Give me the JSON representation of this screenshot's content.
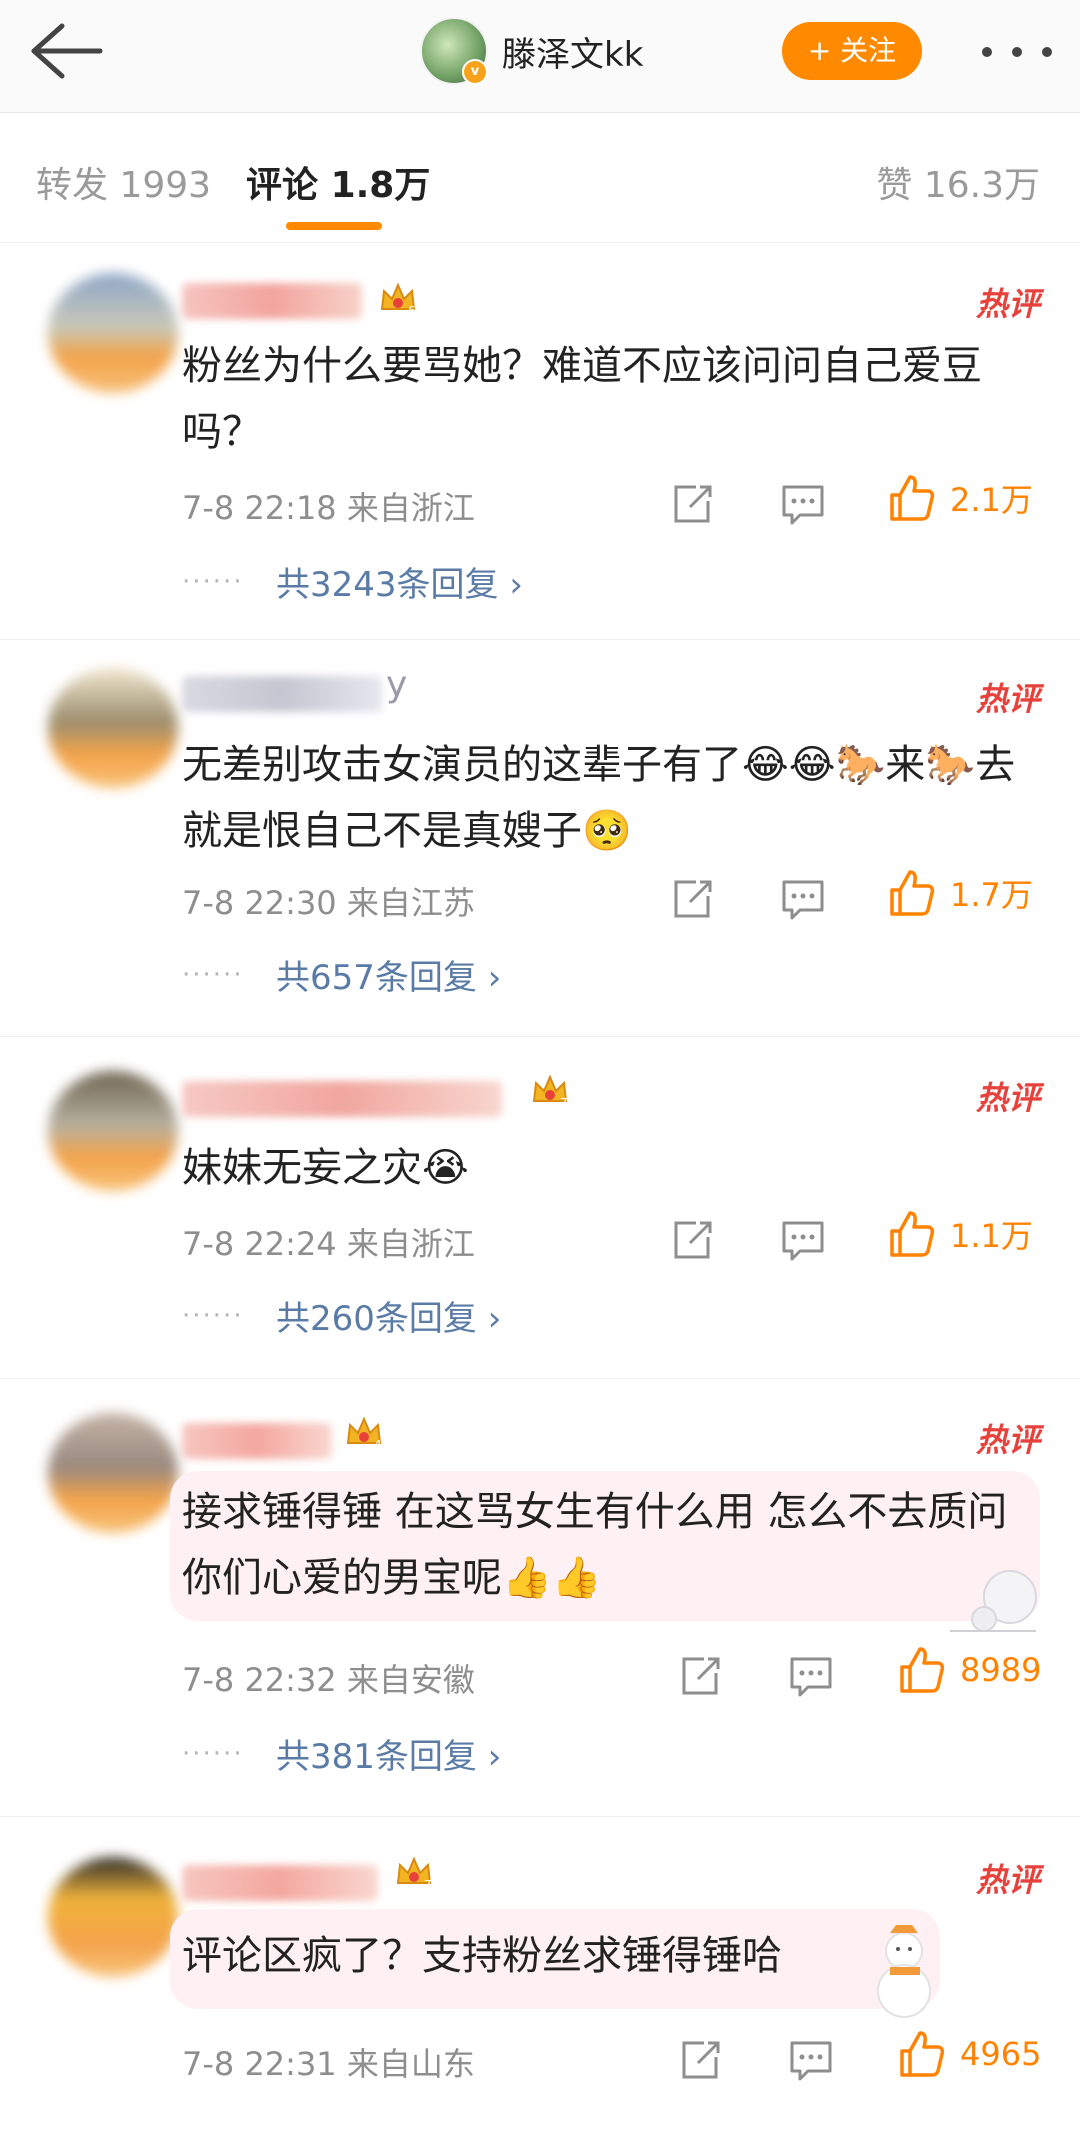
{
  "header": {
    "username": "滕泽文kk",
    "follow_label": "+ 关注",
    "verified_mark": "v"
  },
  "tabs": {
    "repost_label": "转发",
    "repost_count": "1993",
    "comment_label": "评论",
    "comment_count": "1.8万",
    "like_label": "赞",
    "like_count": "16.3万"
  },
  "colors": {
    "accent": "#ff8a00",
    "hot": "#e8413b",
    "link": "#5b7ba7",
    "meta": "#8e8e8e"
  },
  "comments": [
    {
      "badge": "热评",
      "text": "粉丝为什么要骂她？难道不应该问问自己爱豆吗？",
      "time": "7-8 22:18",
      "location": "来自浙江",
      "likes": "2.1万",
      "replies": "共3243条回复 ›",
      "crown_level": "6"
    },
    {
      "badge": "热评",
      "text": "无差别攻击女演员的这辈子有了😂😂🐎来🐎去就是恨自己不是真嫂子🥺",
      "time": "7-8 22:30",
      "location": "来自江苏",
      "likes": "1.7万",
      "replies": "共657条回复 ›",
      "name_suffix": "y"
    },
    {
      "badge": "热评",
      "text": "妹妹无妄之灾😭",
      "time": "7-8 22:24",
      "location": "来自浙江",
      "likes": "1.1万",
      "replies": "共260条回复 ›",
      "crown_level": "7"
    },
    {
      "badge": "热评",
      "text": "接求锤得锤 在这骂女生有什么用 怎么不去质问你们心爱的男宝呢👍👍",
      "time": "7-8 22:32",
      "location": "来自安徽",
      "likes": "8989",
      "replies": "共381条回复 ›",
      "crown_level": "4"
    },
    {
      "badge": "热评",
      "text": "评论区疯了？支持粉丝求锤得锤哈",
      "time": "7-8 22:31",
      "location": "来自山东",
      "likes": "4965",
      "crown_level": "7"
    }
  ],
  "icons": [
    "back-arrow-icon",
    "more-icon",
    "crown-icon",
    "share-icon",
    "comment-icon",
    "like-icon",
    "chevron-right-icon"
  ]
}
